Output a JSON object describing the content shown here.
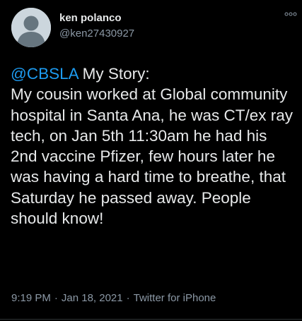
{
  "user": {
    "display_name": "ken polanco",
    "handle": "@ken27430927",
    "avatar_icon": "default-avatar-icon"
  },
  "menu": {
    "icon": "more-dots-icon"
  },
  "tweet": {
    "mention": "@CBSLA",
    "text": " My Story:\nMy cousin worked at Global community hospital in Santa Ana, he was CT/ex ray tech, on Jan 5th 11:30am he had his 2nd vaccine Pfizer, few hours later he was having a hard time to breathe, that Saturday he passed away. People should know!"
  },
  "meta": {
    "time": "9:19 PM",
    "separator": "·",
    "date": "Jan 18, 2021",
    "source": "Twitter for iPhone"
  },
  "colors": {
    "background": "#000000",
    "text": "#e7e9ea",
    "secondary": "#8b98a5",
    "mention": "#1d9bf0"
  }
}
